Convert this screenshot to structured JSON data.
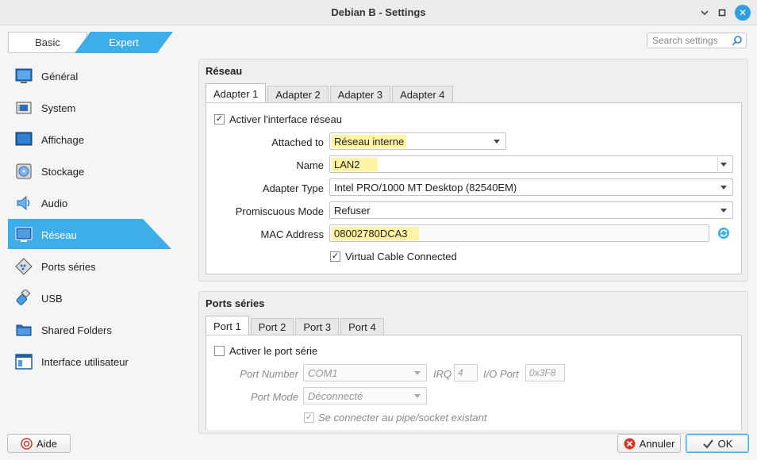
{
  "window": {
    "title": "Debian B - Settings"
  },
  "mode": {
    "basic": "Basic",
    "expert": "Expert"
  },
  "search": {
    "placeholder": "Search settings"
  },
  "nav": [
    {
      "label": "Général",
      "icon": "monitor-icon"
    },
    {
      "label": "System",
      "icon": "chip-icon"
    },
    {
      "label": "Affichage",
      "icon": "display-icon"
    },
    {
      "label": "Stockage",
      "icon": "disk-icon"
    },
    {
      "label": "Audio",
      "icon": "speaker-icon"
    },
    {
      "label": "Réseau",
      "icon": "network-icon",
      "active": true
    },
    {
      "label": "Ports séries",
      "icon": "serial-port-icon"
    },
    {
      "label": "USB",
      "icon": "usb-icon"
    },
    {
      "label": "Shared Folders",
      "icon": "folder-icon"
    },
    {
      "label": "Interface utilisateur",
      "icon": "ui-window-icon"
    }
  ],
  "network": {
    "title": "Réseau",
    "tabs": [
      "Adapter 1",
      "Adapter 2",
      "Adapter 3",
      "Adapter 4"
    ],
    "enable_label": "Activer l'interface réseau",
    "enable_checked": true,
    "attached_label": "Attached to",
    "attached_value": "Réseau interne",
    "name_label": "Name",
    "name_value": "LAN2",
    "adapter_type_label": "Adapter Type",
    "adapter_type_value": "Intel PRO/1000 MT Desktop (82540EM)",
    "promisc_label": "Promiscuous Mode",
    "promisc_value": "Refuser",
    "mac_label": "MAC Address",
    "mac_value": "08002780DCA3",
    "cable_label": "Virtual Cable Connected",
    "cable_checked": true
  },
  "serial": {
    "title": "Ports séries",
    "tabs": [
      "Port 1",
      "Port 2",
      "Port 3",
      "Port 4"
    ],
    "enable_label": "Activer le port série",
    "enable_checked": false,
    "port_number_label": "Port Number",
    "port_number_value": "COM1",
    "irq_label": "IRQ",
    "irq_value": "4",
    "io_label": "I/O Port",
    "io_value": "0x3F8",
    "port_mode_label": "Port Mode",
    "port_mode_value": "Déconnecté",
    "pipe_label": "Se connecter au pipe/socket existant",
    "pipe_checked": true
  },
  "footer": {
    "help": "Aide",
    "cancel": "Annuler",
    "ok": "OK"
  },
  "colors": {
    "accent": "#3daee9",
    "highlight": "#fff4a3"
  }
}
